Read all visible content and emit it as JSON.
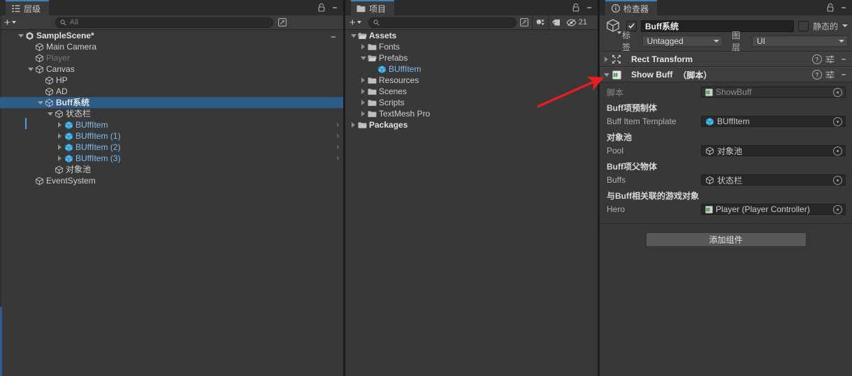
{
  "hierarchy": {
    "tab_label": "层级",
    "tab_icon": "hierarchy-icon",
    "add_label": "+",
    "search_placeholder": "All",
    "search_icon": "search-icon",
    "expand_icon": "expand-search-icon",
    "lock_icon": "lock-icon",
    "menu_icon": "kebab-menu-icon",
    "rows": [
      {
        "label": "SampleScene*",
        "indent": 1,
        "arrow": "down",
        "icon": "unity-scene-icon",
        "style": "bold",
        "kebab": true
      },
      {
        "label": "Main Camera",
        "indent": 2,
        "arrow": "none",
        "icon": "gameobject-cube-icon",
        "style": "normal"
      },
      {
        "label": "Player",
        "indent": 2,
        "arrow": "none",
        "icon": "gameobject-cube-icon",
        "style": "dim"
      },
      {
        "label": "Canvas",
        "indent": 2,
        "arrow": "down",
        "icon": "gameobject-cube-icon",
        "style": "normal"
      },
      {
        "label": "HP",
        "indent": 3,
        "arrow": "none",
        "icon": "gameobject-cube-icon",
        "style": "normal"
      },
      {
        "label": "AD",
        "indent": 3,
        "arrow": "none",
        "icon": "gameobject-cube-icon",
        "style": "normal"
      },
      {
        "label": "Buff系统",
        "indent": 3,
        "arrow": "down",
        "icon": "gameobject-cube-icon",
        "style": "bold",
        "selected": true
      },
      {
        "label": "状态栏",
        "indent": 4,
        "arrow": "down",
        "icon": "gameobject-cube-icon",
        "style": "normal"
      },
      {
        "label": "BUffItem",
        "indent": 5,
        "arrow": "right",
        "icon": "prefab-cube-icon",
        "style": "prefab",
        "chevron": true
      },
      {
        "label": "BUffItem (1)",
        "indent": 5,
        "arrow": "right",
        "icon": "prefab-cube-icon",
        "style": "prefab",
        "chevron": true
      },
      {
        "label": "BUffItem (2)",
        "indent": 5,
        "arrow": "right",
        "icon": "prefab-cube-icon",
        "style": "prefab",
        "chevron": true
      },
      {
        "label": "BUffItem (3)",
        "indent": 5,
        "arrow": "right",
        "icon": "prefab-cube-icon",
        "style": "prefab",
        "chevron": true
      },
      {
        "label": "对象池",
        "indent": 4,
        "arrow": "none",
        "icon": "gameobject-cube-icon",
        "style": "normal"
      },
      {
        "label": "EventSystem",
        "indent": 2,
        "arrow": "none",
        "icon": "gameobject-cube-icon",
        "style": "normal"
      }
    ]
  },
  "project": {
    "tab_label": "项目",
    "tab_icon": "folder-icon",
    "add_label": "+",
    "search_placeholder": "",
    "search_icon": "search-icon",
    "expand_icon": "expand-search-icon",
    "lock_icon": "lock-icon",
    "menu_icon": "kebab-menu-icon",
    "filter_type_icon": "filter-by-type-icon",
    "filter_label_icon": "filter-by-label-icon",
    "hidden_count_icon": "eye-off-icon",
    "hidden_count": "21",
    "rows": [
      {
        "label": "Assets",
        "indent": 0,
        "arrow": "down",
        "icon": "folder-open-icon",
        "style": "bold"
      },
      {
        "label": "Fonts",
        "indent": 1,
        "arrow": "right",
        "icon": "folder-icon",
        "style": "normal"
      },
      {
        "label": "Prefabs",
        "indent": 1,
        "arrow": "down",
        "icon": "folder-open-icon",
        "style": "normal"
      },
      {
        "label": "BUffItem",
        "indent": 2,
        "arrow": "none",
        "icon": "prefab-cube-icon",
        "style": "prefab"
      },
      {
        "label": "Resources",
        "indent": 1,
        "arrow": "right",
        "icon": "folder-icon",
        "style": "normal"
      },
      {
        "label": "Scenes",
        "indent": 1,
        "arrow": "right",
        "icon": "folder-icon",
        "style": "normal"
      },
      {
        "label": "Scripts",
        "indent": 1,
        "arrow": "right",
        "icon": "folder-icon",
        "style": "normal"
      },
      {
        "label": "TextMesh Pro",
        "indent": 1,
        "arrow": "right",
        "icon": "folder-icon",
        "style": "normal"
      },
      {
        "label": "Packages",
        "indent": 0,
        "arrow": "right",
        "icon": "folder-icon",
        "style": "bold"
      }
    ]
  },
  "inspector": {
    "tab_label": "检查器",
    "tab_icon": "info-icon",
    "lock_icon": "lock-icon",
    "menu_icon": "kebab-menu-icon",
    "object_icon": "gameobject-cube-icon",
    "enabled_checked": true,
    "object_name": "Buff系统",
    "static_label": "静态的",
    "static_checked": false,
    "tag_label": "标签",
    "tag_value": "Untagged",
    "layer_label": "图层",
    "layer_value": "UI",
    "components": [
      {
        "name": "Rect Transform",
        "suffix": "",
        "icon": "rect-transform-icon",
        "expanded": false,
        "help_icon": "help-icon",
        "preset_icon": "preset-settings-icon",
        "menu_icon": "kebab-menu-icon"
      },
      {
        "name": "Show Buff",
        "suffix": "（脚本）",
        "icon": "csharp-script-icon",
        "expanded": true,
        "help_icon": "help-icon",
        "preset_icon": "preset-settings-icon",
        "menu_icon": "kebab-menu-icon"
      }
    ],
    "fields": [
      {
        "kind": "row",
        "label": "脚本",
        "value": "ShowBuff",
        "value_icon": "csharp-script-icon",
        "disabled": true,
        "picker_icon": "object-picker-icon"
      },
      {
        "kind": "group",
        "label": "Buff项预制体"
      },
      {
        "kind": "row",
        "label": "Buff Item Template",
        "value": "BUffItem",
        "value_icon": "prefab-cube-icon",
        "disabled": false,
        "picker_icon": "object-picker-icon"
      },
      {
        "kind": "group",
        "label": "对象池"
      },
      {
        "kind": "row",
        "label": "Pool",
        "value": "对象池",
        "value_icon": "gameobject-cube-icon",
        "disabled": false,
        "picker_icon": "object-picker-icon"
      },
      {
        "kind": "group",
        "label": "Buff项父物体"
      },
      {
        "kind": "row",
        "label": "Buffs",
        "value": "状态栏",
        "value_icon": "gameobject-cube-icon",
        "disabled": false,
        "picker_icon": "object-picker-icon"
      },
      {
        "kind": "group",
        "label": "与Buff相关联的游戏对象"
      },
      {
        "kind": "row",
        "label": "Hero",
        "value": "Player (Player Controller)",
        "value_icon": "csharp-script-icon",
        "disabled": false,
        "picker_icon": "object-picker-icon"
      }
    ],
    "add_component_label": "添加组件"
  },
  "annotation": {
    "arrow_icon": "red-arrow-annotation",
    "color": "#e81e1e"
  },
  "colors": {
    "selection_blue": "#2d5c87",
    "prefab_blue": "#7fbcf0",
    "panel_bg": "#383838",
    "toolbar_bg": "#3c3c3c",
    "tab_active": "#3b3b3b",
    "accent": "#3b82c4"
  }
}
